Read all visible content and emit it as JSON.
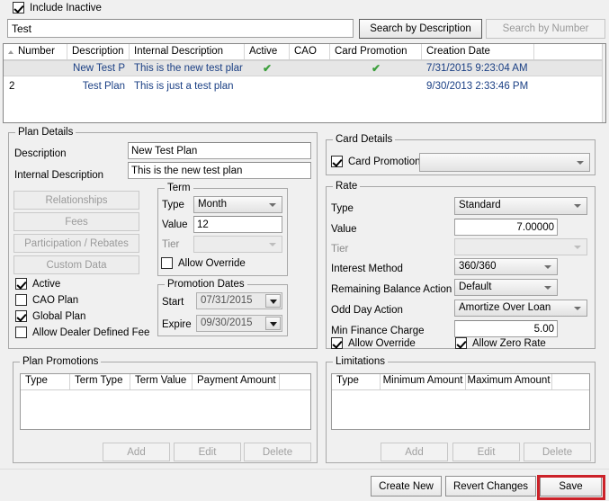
{
  "topbar": {
    "include_inactive_label": "Include Inactive",
    "include_inactive_checked": true,
    "search_value": "Test",
    "search_placeholder": "",
    "search_by_description": "Search by Description",
    "search_by_number": "Search by Number"
  },
  "grid": {
    "columns": [
      "Number",
      "Description",
      "Internal Description",
      "Active",
      "CAO",
      "Card Promotion",
      "Creation Date",
      ""
    ],
    "sort_column": "Number",
    "sort_direction": "asc",
    "rows": [
      {
        "number": "",
        "description": "New Test P",
        "internal_description": "This is the new test plar",
        "active": "✔",
        "cao": "",
        "card_promotion": "✔",
        "creation_date": "7/31/2015 9:23:04 AM",
        "selected": true
      },
      {
        "number": "2",
        "description": "Test Plan",
        "internal_description": "This is just a test plan",
        "active": "",
        "cao": "",
        "card_promotion": "",
        "creation_date": "9/30/2013 2:33:46 PM",
        "selected": false
      }
    ]
  },
  "plan_details": {
    "title": "Plan Details",
    "description_label": "Description",
    "description_value": "New Test Plan",
    "internal_description_label": "Internal Description",
    "internal_description_value": "This is the new test plan",
    "buttons": [
      "Relationships",
      "Fees",
      "Participation / Rebates",
      "Custom Data"
    ],
    "checkboxes": [
      {
        "label": "Active",
        "checked": true
      },
      {
        "label": "CAO Plan",
        "checked": false
      },
      {
        "label": "Global Plan",
        "checked": true
      },
      {
        "label": "Allow Dealer Defined Fee",
        "checked": false
      }
    ]
  },
  "term": {
    "title": "Term",
    "type_label": "Type",
    "type_value": "Month",
    "value_label": "Value",
    "value_value": "12",
    "tier_label": "Tier",
    "tier_value": "",
    "allow_override_label": "Allow Override",
    "allow_override_checked": false
  },
  "promotion_dates": {
    "title": "Promotion Dates",
    "start_label": "Start",
    "start_value": "07/31/2015",
    "expire_label": "Expire",
    "expire_value": "09/30/2015"
  },
  "card_details": {
    "title": "Card Details",
    "card_promotion_label": "Card Promotion",
    "card_promotion_checked": true,
    "card_promotion_value": ""
  },
  "rate": {
    "title": "Rate",
    "type_label": "Type",
    "type_value": "Standard",
    "value_label": "Value",
    "value_value": "7.00000",
    "tier_label": "Tier",
    "tier_value": "",
    "interest_method_label": "Interest Method",
    "interest_method_value": "360/360",
    "remaining_balance_label": "Remaining Balance Action",
    "remaining_balance_value": "Default",
    "odd_day_label": "Odd Day Action",
    "odd_day_value": "Amortize Over Loan",
    "min_finance_label": "Min Finance Charge",
    "min_finance_value": "5.00",
    "allow_override_label": "Allow Override",
    "allow_override_checked": true,
    "allow_zero_rate_label": "Allow Zero Rate",
    "allow_zero_rate_checked": true
  },
  "plan_promotions": {
    "title": "Plan Promotions",
    "columns": [
      "Type",
      "Term Type",
      "Term Value",
      "Payment Amount",
      ""
    ],
    "rows": [],
    "add_label": "Add",
    "edit_label": "Edit",
    "delete_label": "Delete"
  },
  "limitations": {
    "title": "Limitations",
    "columns": [
      "Type",
      "Minimum Amount",
      "Maximum Amount",
      ""
    ],
    "rows": [],
    "add_label": "Add",
    "edit_label": "Edit",
    "delete_label": "Delete"
  },
  "footer": {
    "create_new": "Create New",
    "revert_changes": "Revert Changes",
    "save": "Save"
  },
  "colors": {
    "highlight_box": "#cc2229",
    "grid_link_text": "#1a3f84",
    "checkmark_green": "#3c9f3c",
    "window_bg": "#f0f0f0"
  }
}
